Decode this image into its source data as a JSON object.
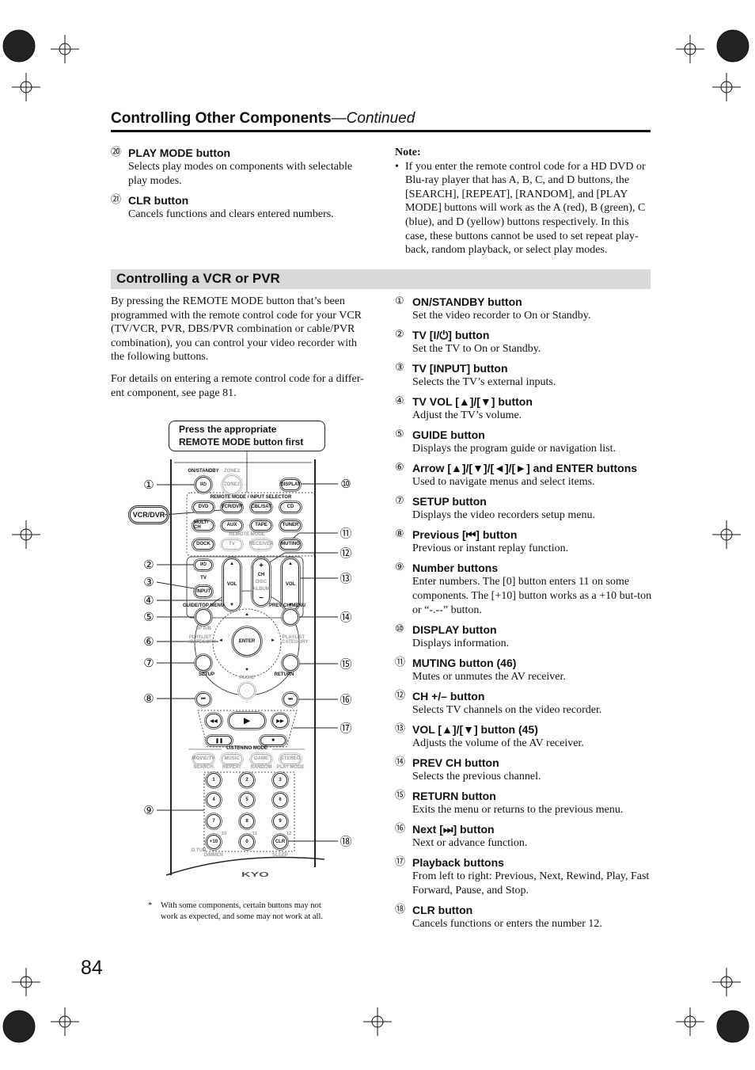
{
  "header": {
    "title": "Controlling Other Components",
    "continued": "—Continued"
  },
  "top_items": [
    {
      "num": "⑳",
      "title": "PLAY MODE button",
      "desc": "Selects play modes on components with selectable play modes."
    },
    {
      "num": "㉑",
      "title": "CLR button",
      "desc": "Cancels functions and clears entered numbers."
    }
  ],
  "note": {
    "title": "Note:",
    "bullet": "•",
    "text": "If you enter the remote control code for a HD DVD or Blu-ray player that has A, B, C, and D buttons, the [SEARCH], [REPEAT], [RANDOM], and [PLAY MODE] buttons will work as the A (red), B (green), C (blue), and D (yellow) buttons respectively. In this case, these buttons cannot be used to set repeat play-back, random playback, or select play modes."
  },
  "section": {
    "title": "Controlling a VCR or PVR",
    "para1": "By pressing the REMOTE MODE button that’s been programmed with the remote control code for your VCR (TV/VCR, PVR, DBS/PVR combination or cable/PVR combination), you can control your video recorder with the following buttons.",
    "para2": "For details on entering a remote control code for a differ-ent component, see page 81."
  },
  "callout_box": "Press the appropriate REMOTE MODE button first",
  "vcr_label": "VCR/DVR",
  "remote": {
    "on_standby": "ON/STANDBY",
    "zone2": "ZONE2",
    "power": "I/⏻",
    "display": "DISPLAY",
    "selector": "REMOTE MODE / INPUT SELECTOR",
    "dvd": "DVD",
    "vcr": "VCR/DVR",
    "cbl": "CBL/SAT",
    "cd": "CD",
    "multich": "MULTI CH",
    "aux": "AUX",
    "tape": "TAPE",
    "tuner": "TUNER",
    "dock": "DOCK",
    "tv": "TV",
    "receiver": "RECEIVER",
    "muting": "MUTING",
    "remote_mode": "REMOTE MODE",
    "tv_power": "I/⏻",
    "tv_label": "TV",
    "input": "INPUT",
    "vol": "VOL",
    "ch": "CH",
    "disc": "DISC",
    "album": "ALBUM",
    "plus": "+",
    "minus": "−",
    "up": "▲",
    "down": "▼",
    "guide": "GUIDE/TOP MENU",
    "prevch": "PREV CH/MENU",
    "spab": "SP A/B",
    "playlist_l": "PLAYLIST /CATEGORY",
    "playlist_r": "PLAYLIST CATEGORY",
    "enter": "ENTER",
    "left": "◄",
    "right": "►",
    "setup": "SETUP",
    "return": "RETURN",
    "audio": "AUDIO",
    "prev": "⏮",
    "next": "⏭",
    "rew": "◀◀",
    "play": "▶",
    "ff": "▶▶",
    "pause": "❚❚",
    "stop": "■",
    "listening": "LISTENING MODE",
    "movie": "MOVIE/TV",
    "music": "MUSIC",
    "game": "GAME",
    "stereo": "STEREO",
    "search": "SEARCH",
    "repeat": "REPEAT",
    "random": "RANDOM",
    "playmode": "PLAY MODE",
    "n1": "1",
    "n2": "2",
    "n3": "3",
    "n4": "4",
    "n5": "5",
    "n6": "6",
    "n7": "7",
    "n8": "8",
    "n9": "9",
    "n10": "+10",
    "n0": "0",
    "clr": "CLR",
    "l10": "10",
    "l11": "11",
    "l12": "12",
    "dtun": "D.TUN",
    "dimmer": "DIMMER",
    "sleep": "SLEEP",
    "logo": "ONKYO"
  },
  "callouts": [
    "①",
    "②",
    "③",
    "④",
    "⑤",
    "⑥",
    "⑦",
    "⑧",
    "⑨",
    "⑩",
    "⑪",
    "⑫",
    "⑬",
    "⑭",
    "⑮",
    "⑯",
    "⑰",
    "⑱"
  ],
  "footnote": {
    "mark": "*",
    "text": "With some components, certain buttons may not work as expected, and some may not work at all."
  },
  "items": [
    {
      "num": "①",
      "title": "ON/STANDBY button",
      "desc": "Set the video recorder to On or Standby."
    },
    {
      "num": "②",
      "title": "TV [I/⏻] button",
      "desc": "Set the TV to On or Standby."
    },
    {
      "num": "③",
      "title": "TV [INPUT] button",
      "desc": "Selects the TV’s external inputs."
    },
    {
      "num": "④",
      "title": "TV VOL [▲]/[▼] button",
      "desc": "Adjust the TV’s volume."
    },
    {
      "num": "⑤",
      "title": "GUIDE button",
      "desc": "Displays the program guide or navigation list."
    },
    {
      "num": "⑥",
      "title": "Arrow [▲]/[▼]/[◄]/[►] and ENTER buttons",
      "desc": "Used to navigate menus and select items."
    },
    {
      "num": "⑦",
      "title": "SETUP button",
      "desc": "Displays the video recorders setup menu."
    },
    {
      "num": "⑧",
      "title": "Previous [⏮] button",
      "desc": "Previous or instant replay function."
    },
    {
      "num": "⑨",
      "title": "Number buttons",
      "desc": "Enter numbers. The [0] button enters 11 on some components. The [+10] button works as a +10 but-ton or “-.--” button."
    },
    {
      "num": "⑩",
      "title": "DISPLAY button",
      "desc": "Displays information."
    },
    {
      "num": "⑪",
      "title": "MUTING button (46)",
      "desc": "Mutes or unmutes the AV receiver."
    },
    {
      "num": "⑫",
      "title": "CH +/– button",
      "desc": "Selects TV channels on the video recorder."
    },
    {
      "num": "⑬",
      "title": "VOL [▲]/[▼] button (45)",
      "desc": "Adjusts the volume of the AV receiver."
    },
    {
      "num": "⑭",
      "title": "PREV CH button",
      "desc": "Selects the previous channel."
    },
    {
      "num": "⑮",
      "title": "RETURN button",
      "desc": "Exits the menu or returns to the previous menu."
    },
    {
      "num": "⑯",
      "title": "Next [⏭] button",
      "desc": "Next or advance function."
    },
    {
      "num": "⑰",
      "title": "Playback buttons",
      "desc": "From left to right: Previous, Next, Rewind, Play, Fast Forward, Pause, and Stop."
    },
    {
      "num": "⑱",
      "title": "CLR button",
      "desc": "Cancels functions or enters the number 12."
    }
  ],
  "page_number": "84"
}
